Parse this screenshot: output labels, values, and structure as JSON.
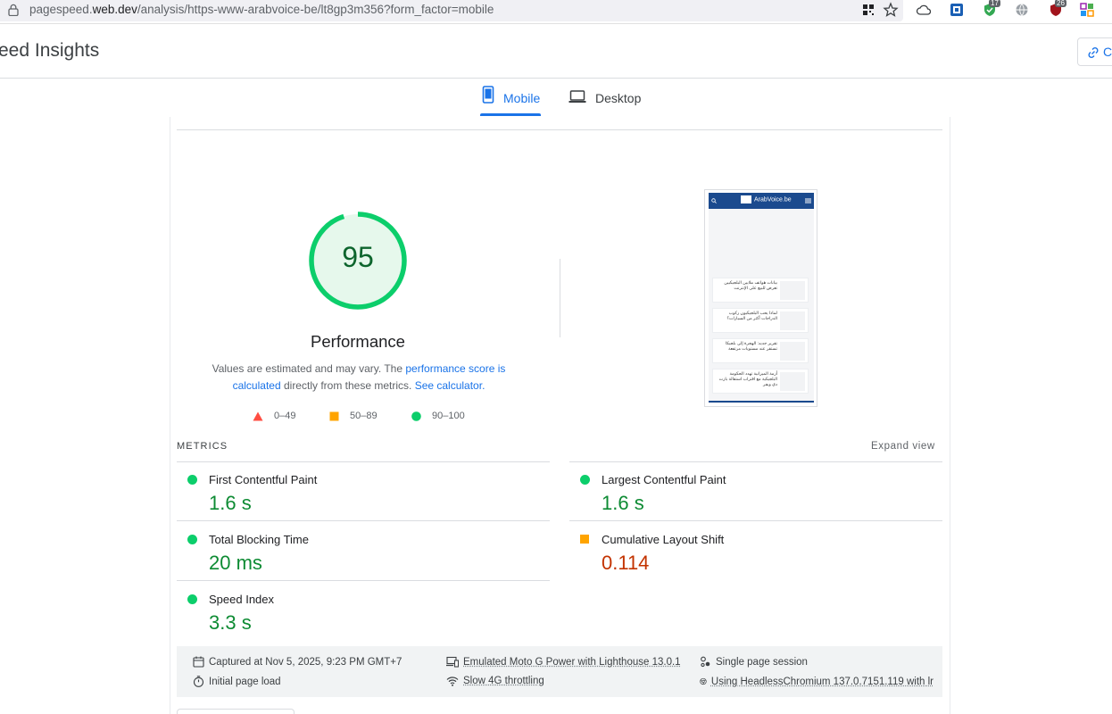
{
  "browser": {
    "url_prefix": "pagespeed.",
    "url_domain": "web.dev",
    "url_path": "/analysis/https-www-arabvoice-be/lt8gp3m356?form_factor=mobile",
    "badge_1": "17",
    "badge_2": "26"
  },
  "header": {
    "brand": "eed Insights",
    "copy_label": "C"
  },
  "tabs": [
    {
      "label": "Mobile"
    },
    {
      "label": "Desktop"
    }
  ],
  "performance": {
    "score": "95",
    "score_fraction": 0.95,
    "title": "Performance",
    "desc_1": "Values are estimated and may vary. The ",
    "link_1": "performance score is calculated",
    "desc_2": " directly from these metrics. ",
    "link_2": "See calculator."
  },
  "legend": [
    {
      "range": "0–49"
    },
    {
      "range": "50–89"
    },
    {
      "range": "90–100"
    }
  ],
  "thumbnail": {
    "logo": "ArabVoice.be",
    "items": [
      "بيانات هواتف ملايين البلجيكيين تعرض للبيع على الإنترنت",
      "لماذا يحب البلجيكيون ركوب الدراجات أكثر من السيارات؟",
      "تقرير جديد: الهجرة إلى بلجيكا تستقر عند مستويات مرتفعة",
      "أزمة الميزانية تهدد الحكومة البلجيكية مع اقتراب استقالة بارت دي ويفر"
    ]
  },
  "metrics": {
    "label": "METRICS",
    "expand": "Expand view",
    "items": [
      {
        "name": "First Contentful Paint",
        "value": "1.6 s"
      },
      {
        "name": "Largest Contentful Paint",
        "value": "1.6 s"
      },
      {
        "name": "Total Blocking Time",
        "value": "20 ms"
      },
      {
        "name": "Cumulative Layout Shift",
        "value": "0.114"
      },
      {
        "name": "Speed Index",
        "value": "3.3 s"
      }
    ]
  },
  "runtime": {
    "captured": "Captured at Nov 5, 2025, 9:23 PM GMT+7",
    "device": "Emulated Moto G Power with Lighthouse 13.0.1",
    "session": "Single page session",
    "load": "Initial page load",
    "throttle": "Slow 4G throttling",
    "browser": "Using HeadlessChromium 137.0.7151.119 with lr"
  },
  "colors": {
    "pass": "#0cce6b",
    "average": "#ffa400",
    "fail": "#ff4e42",
    "accent": "#1a73e8"
  }
}
